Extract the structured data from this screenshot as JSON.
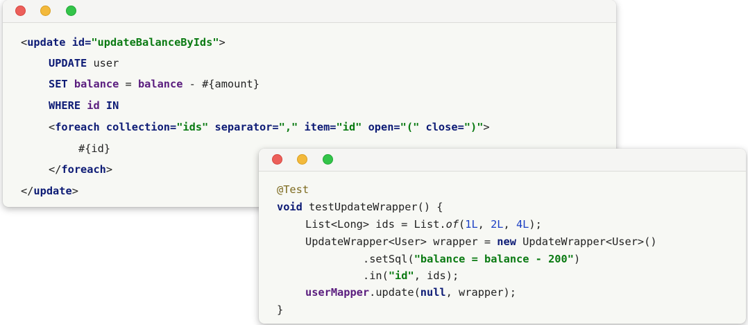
{
  "window1": {
    "lines": [
      {
        "tokens": [
          {
            "t": "<",
            "c": "plain"
          },
          {
            "t": "update",
            "c": "tag"
          },
          {
            "t": " ",
            "c": "plain"
          },
          {
            "t": "id=",
            "c": "attr"
          },
          {
            "t": "\"updateBalanceByIds\"",
            "c": "str"
          },
          {
            "t": ">",
            "c": "plain"
          }
        ]
      },
      {
        "tokens": [
          {
            "t": "UPDATE",
            "c": "kw"
          },
          {
            "t": " user",
            "c": "plain"
          }
        ]
      },
      {
        "tokens": [
          {
            "t": "SET",
            "c": "kw"
          },
          {
            "t": " ",
            "c": "plain"
          },
          {
            "t": "balance",
            "c": "purple"
          },
          {
            "t": " = ",
            "c": "plain"
          },
          {
            "t": "balance",
            "c": "purple"
          },
          {
            "t": " - #{amount}",
            "c": "plain"
          }
        ]
      },
      {
        "tokens": [
          {
            "t": "WHERE",
            "c": "kw"
          },
          {
            "t": " ",
            "c": "plain"
          },
          {
            "t": "id",
            "c": "purple"
          },
          {
            "t": " ",
            "c": "plain"
          },
          {
            "t": "IN",
            "c": "kw"
          }
        ]
      },
      {
        "tokens": [
          {
            "t": "<",
            "c": "plain"
          },
          {
            "t": "foreach",
            "c": "tag"
          },
          {
            "t": " ",
            "c": "plain"
          },
          {
            "t": "collection=",
            "c": "attr"
          },
          {
            "t": "\"ids\"",
            "c": "str"
          },
          {
            "t": " ",
            "c": "plain"
          },
          {
            "t": "separator=",
            "c": "attr"
          },
          {
            "t": "\",\"",
            "c": "str"
          },
          {
            "t": " ",
            "c": "plain"
          },
          {
            "t": "item=",
            "c": "attr"
          },
          {
            "t": "\"id\"",
            "c": "str"
          },
          {
            "t": " ",
            "c": "plain"
          },
          {
            "t": "open=",
            "c": "attr"
          },
          {
            "t": "\"(\"",
            "c": "str"
          },
          {
            "t": " ",
            "c": "plain"
          },
          {
            "t": "close=",
            "c": "attr"
          },
          {
            "t": "\")\"",
            "c": "str"
          },
          {
            "t": ">",
            "c": "plain"
          }
        ]
      },
      {
        "tokens": [
          {
            "t": "#{id}",
            "c": "plain"
          }
        ]
      },
      {
        "tokens": [
          {
            "t": "</",
            "c": "plain"
          },
          {
            "t": "foreach",
            "c": "tag"
          },
          {
            "t": ">",
            "c": "plain"
          }
        ]
      },
      {
        "tokens": [
          {
            "t": "</",
            "c": "plain"
          },
          {
            "t": "update",
            "c": "tag"
          },
          {
            "t": ">",
            "c": "plain"
          }
        ]
      }
    ]
  },
  "window2": {
    "lines": [
      {
        "tokens": [
          {
            "t": "@Test",
            "c": "anno"
          }
        ]
      },
      {
        "tokens": [
          {
            "t": "void",
            "c": "kw"
          },
          {
            "t": " testUpdateWrapper() {",
            "c": "plain"
          }
        ]
      },
      {
        "tokens": [
          {
            "t": "List<Long> ids = List.",
            "c": "plain"
          },
          {
            "t": "of",
            "c": "ital"
          },
          {
            "t": "(",
            "c": "plain"
          },
          {
            "t": "1L",
            "c": "num"
          },
          {
            "t": ", ",
            "c": "plain"
          },
          {
            "t": "2L",
            "c": "num"
          },
          {
            "t": ", ",
            "c": "plain"
          },
          {
            "t": "4L",
            "c": "num"
          },
          {
            "t": ");",
            "c": "plain"
          }
        ]
      },
      {
        "tokens": [
          {
            "t": "UpdateWrapper<User> wrapper = ",
            "c": "plain"
          },
          {
            "t": "new",
            "c": "kw"
          },
          {
            "t": " UpdateWrapper<User>()",
            "c": "plain"
          }
        ]
      },
      {
        "tokens": [
          {
            "t": ".setSql(",
            "c": "plain"
          },
          {
            "t": "\"balance = balance - 200\"",
            "c": "str"
          },
          {
            "t": ")",
            "c": "plain"
          }
        ]
      },
      {
        "tokens": [
          {
            "t": ".in(",
            "c": "plain"
          },
          {
            "t": "\"id\"",
            "c": "str"
          },
          {
            "t": ", ids);",
            "c": "plain"
          }
        ]
      },
      {
        "tokens": [
          {
            "t": "userMapper",
            "c": "purple"
          },
          {
            "t": ".update(",
            "c": "plain"
          },
          {
            "t": "null",
            "c": "kw"
          },
          {
            "t": ", wrapper);",
            "c": "plain"
          }
        ]
      },
      {
        "tokens": [
          {
            "t": "}",
            "c": "plain"
          }
        ]
      }
    ]
  }
}
